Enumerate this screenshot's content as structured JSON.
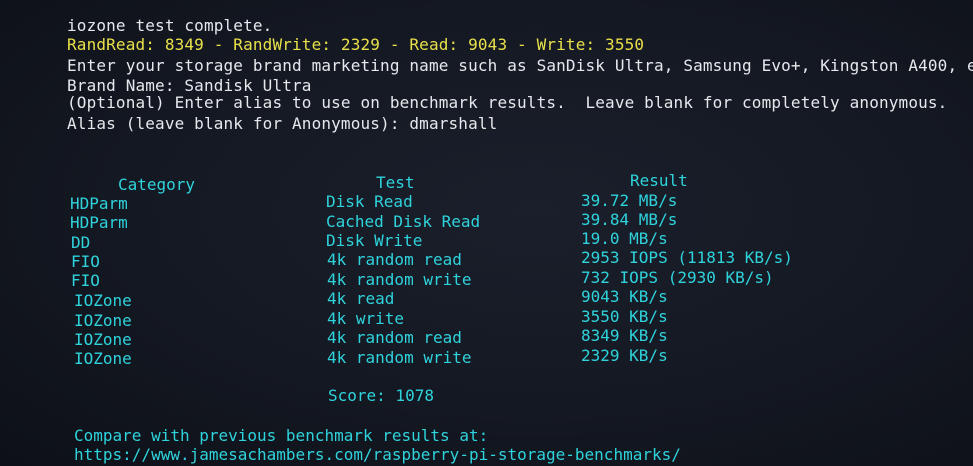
{
  "terminal": {
    "line1": "iozone test complete.",
    "line2": "RandRead: 8349 - RandWrite: 2329 - Read: 9043 - Write: 3550",
    "line3": "Enter your storage brand marketing name such as SanDisk Ultra, Samsung Evo+, Kingston A400, e",
    "line4": "Brand Name: Sandisk Ultra",
    "line5": "(Optional) Enter alias to use on benchmark results.  Leave blank for completely anonymous.",
    "line6": "Alias (leave blank for Anonymous): dmarshall"
  },
  "results": {
    "headers": {
      "category": "Category",
      "test": "Test",
      "result": "Result"
    },
    "rows": [
      {
        "category": "HDParm",
        "test": "Disk Read",
        "result": "39.72 MB/s"
      },
      {
        "category": "HDParm",
        "test": "Cached Disk Read",
        "result": "39.84 MB/s"
      },
      {
        "category": "DD",
        "test": "Disk Write",
        "result": "19.0 MB/s"
      },
      {
        "category": "FIO",
        "test": "4k random read",
        "result": "2953 IOPS (11813 KB/s)"
      },
      {
        "category": "FIO",
        "test": "4k random write",
        "result": "732 IOPS (2930 KB/s)"
      },
      {
        "category": "IOZone",
        "test": "4k read",
        "result": "9043 KB/s"
      },
      {
        "category": "IOZone",
        "test": "4k write",
        "result": "3550 KB/s"
      },
      {
        "category": "IOZone",
        "test": "4k random read",
        "result": "8349 KB/s"
      },
      {
        "category": "IOZone",
        "test": "4k random write",
        "result": "2329 KB/s"
      }
    ],
    "score": "Score: 1078",
    "compare_line": "Compare with previous benchmark results at:",
    "compare_url": "https://www.jamesachambers.com/raspberry-pi-storage-benchmarks/"
  },
  "colors": {
    "background": "#141822",
    "text_white": "#e6e8ec",
    "text_yellow": "#e8e04a",
    "text_cyan": "#2fd3dc"
  }
}
